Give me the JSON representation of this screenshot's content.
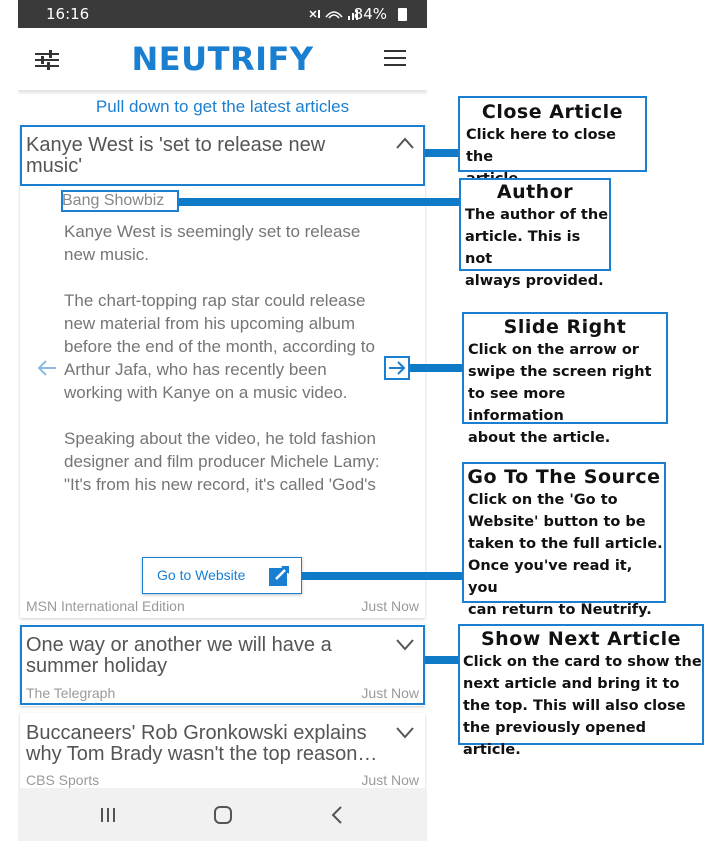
{
  "status_bar": {
    "time": "16:16",
    "battery": "84%"
  },
  "app_bar": {
    "title": "NEUTRIFY"
  },
  "pull_hint": "Pull down to get the latest articles",
  "article1": {
    "title": "Kanye West is 'set to release new music'",
    "author": "Bang Showbiz",
    "paragraphs": [
      "Kanye West is seemingly set to release new music.",
      "The chart-topping rap star could release new material from his upcoming album before the end of the month, according to Arthur Jafa, who has recently been working with Kanye on a music video.",
      "Speaking about the video, he told fashion designer and film producer Michele Lamy: \"It's from his new record, it's called 'God's Country' and…"
    ],
    "go_to_website": "Go to Website",
    "source": "MSN International Edition",
    "time": "Just Now"
  },
  "article2": {
    "title": "One way or another we will have a summer holiday",
    "source": "The Telegraph",
    "time": "Just Now"
  },
  "article3": {
    "title": "Buccaneers' Rob Gronkowski explains why Tom Brady wasn't the top reason…",
    "source": "CBS Sports",
    "time": "Just Now"
  },
  "callouts": {
    "close_article": {
      "heading": "Close Article",
      "body": [
        "Click here to close the",
        "article."
      ]
    },
    "author": {
      "heading": "Author",
      "body": [
        "The author of the",
        "article. This is not",
        "always provided."
      ]
    },
    "slide_right": {
      "heading": "Slide Right",
      "body": [
        "Click on the arrow or",
        "swipe the screen right",
        "to see more information",
        "about the article."
      ]
    },
    "go_to_source": {
      "heading": "Go To The Source",
      "body": [
        "Click on the 'Go to",
        "Website' button to be",
        "taken to the full article.",
        "Once you've read it, you",
        "can return to Neutrify."
      ]
    },
    "show_next": {
      "heading": "Show Next Article",
      "body": [
        "Click on the card to show the",
        "next article and bring it to",
        "the top. This will also close",
        "the previously opened article."
      ]
    }
  },
  "icons": {
    "filter": "sliders-icon",
    "menu": "hamburger-menu-icon",
    "collapse": "chevron-up-icon",
    "expand": "chevron-down-icon",
    "prev": "arrow-left-icon",
    "next": "arrow-right-icon",
    "external": "external-link-icon",
    "nav_recent": "recent-apps-icon",
    "nav_home": "home-icon",
    "nav_back": "back-icon"
  },
  "colors": {
    "accent": "#1a7fd1",
    "connector": "#0f7bc8",
    "status_bar": "#3a3a3a"
  }
}
